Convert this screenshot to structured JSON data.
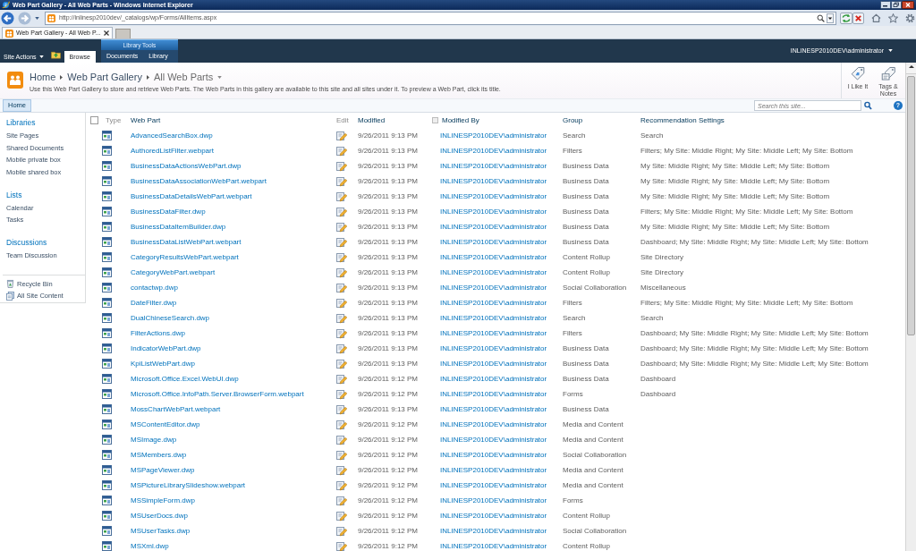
{
  "browser": {
    "title": "Web Part Gallery - All Web Parts - Windows Internet Explorer",
    "address": "http://inlinesp2010dev/_catalogs/wp/Forms/AllItems.aspx",
    "tabs": [
      {
        "label": "Web Part Gallery - All Web P...",
        "selected": true
      }
    ]
  },
  "ribbon": {
    "site_actions": "Site Actions",
    "tabs": [
      {
        "label": "Browse",
        "selected": true
      }
    ],
    "context_group": {
      "label": "Library Tools",
      "tabs": [
        {
          "label": "Documents",
          "selected": false
        },
        {
          "label": "Library",
          "selected": false
        }
      ]
    },
    "user": "INLINESP2010DEV\\administrator"
  },
  "title_area": {
    "breadcrumb": [
      "Home",
      "Web Part Gallery",
      "All Web Parts"
    ],
    "description": "Use this Web Part Gallery to store and retrieve Web Parts. The Web Parts in this gallery are available to this site and all sites under it. To preview a Web Part, click its title.",
    "actions": [
      {
        "kind": "like",
        "label": "I Like It"
      },
      {
        "kind": "tags",
        "label": "Tags & Notes"
      }
    ]
  },
  "top_nav": {
    "tabs": [
      {
        "label": "Home",
        "selected": true
      }
    ],
    "search": {
      "placeholder": "Search this site..."
    },
    "help": "?"
  },
  "quick_launch": {
    "sections": [
      {
        "heading": "Libraries",
        "items": [
          "Site Pages",
          "Shared Documents",
          "Mobile private box",
          "Mobile shared box"
        ]
      },
      {
        "heading": "Lists",
        "items": [
          "Calendar",
          "Tasks"
        ]
      },
      {
        "heading": "Discussions",
        "items": [
          "Team Discussion"
        ]
      }
    ],
    "footer": [
      {
        "kind": "recycle",
        "label": "Recycle Bin"
      },
      {
        "kind": "content",
        "label": "All Site Content"
      }
    ]
  },
  "table": {
    "columns": [
      {
        "kind": "select",
        "checked": false
      },
      {
        "kind": "type",
        "label": "Type",
        "sortable": false
      },
      {
        "kind": "title",
        "label": "Web Part",
        "sortable": true
      },
      {
        "kind": "edit",
        "label": "Edit",
        "sortable": false
      },
      {
        "kind": "modified",
        "label": "Modified",
        "sortable": true
      },
      {
        "kind": "person",
        "label": "Modified By",
        "sortable": true
      },
      {
        "kind": "group",
        "label": "Group",
        "sortable": true
      },
      {
        "kind": "recommendation",
        "label": "Recommendation Settings",
        "sortable": true
      }
    ],
    "rows": [
      {
        "web_part": "AdvancedSearchBox.dwp",
        "modified": "9/26/2011 9:13 PM",
        "modified_by": "INLINESP2010DEV\\administrator",
        "group": "Search",
        "recommendation_settings": "Search"
      },
      {
        "web_part": "AuthoredListFilter.webpart",
        "modified": "9/26/2011 9:13 PM",
        "modified_by": "INLINESP2010DEV\\administrator",
        "group": "Filters",
        "recommendation_settings": "Filters; My Site: Middle Right; My Site: Middle Left; My Site: Bottom"
      },
      {
        "web_part": "BusinessDataActionsWebPart.dwp",
        "modified": "9/26/2011 9:13 PM",
        "modified_by": "INLINESP2010DEV\\administrator",
        "group": "Business Data",
        "recommendation_settings": "My Site: Middle Right; My Site: Middle Left; My Site: Bottom"
      },
      {
        "web_part": "BusinessDataAssociationWebPart.webpart",
        "modified": "9/26/2011 9:13 PM",
        "modified_by": "INLINESP2010DEV\\administrator",
        "group": "Business Data",
        "recommendation_settings": "My Site: Middle Right; My Site: Middle Left; My Site: Bottom"
      },
      {
        "web_part": "BusinessDataDetailsWebPart.webpart",
        "modified": "9/26/2011 9:13 PM",
        "modified_by": "INLINESP2010DEV\\administrator",
        "group": "Business Data",
        "recommendation_settings": "My Site: Middle Right; My Site: Middle Left; My Site: Bottom"
      },
      {
        "web_part": "BusinessDataFilter.dwp",
        "modified": "9/26/2011 9:13 PM",
        "modified_by": "INLINESP2010DEV\\administrator",
        "group": "Business Data",
        "recommendation_settings": "Filters; My Site: Middle Right; My Site: Middle Left; My Site: Bottom"
      },
      {
        "web_part": "BusinessDataItemBuilder.dwp",
        "modified": "9/26/2011 9:13 PM",
        "modified_by": "INLINESP2010DEV\\administrator",
        "group": "Business Data",
        "recommendation_settings": "My Site: Middle Right; My Site: Middle Left; My Site: Bottom"
      },
      {
        "web_part": "BusinessDataListWebPart.webpart",
        "modified": "9/26/2011 9:13 PM",
        "modified_by": "INLINESP2010DEV\\administrator",
        "group": "Business Data",
        "recommendation_settings": "Dashboard; My Site: Middle Right; My Site: Middle Left; My Site: Bottom"
      },
      {
        "web_part": "CategoryResultsWebPart.webpart",
        "modified": "9/26/2011 9:13 PM",
        "modified_by": "INLINESP2010DEV\\administrator",
        "group": "Content Rollup",
        "recommendation_settings": "Site Directory"
      },
      {
        "web_part": "CategoryWebPart.webpart",
        "modified": "9/26/2011 9:13 PM",
        "modified_by": "INLINESP2010DEV\\administrator",
        "group": "Content Rollup",
        "recommendation_settings": "Site Directory"
      },
      {
        "web_part": "contactwp.dwp",
        "modified": "9/26/2011 9:13 PM",
        "modified_by": "INLINESP2010DEV\\administrator",
        "group": "Social Collaboration",
        "recommendation_settings": "Miscellaneous"
      },
      {
        "web_part": "DateFilter.dwp",
        "modified": "9/26/2011 9:13 PM",
        "modified_by": "INLINESP2010DEV\\administrator",
        "group": "Filters",
        "recommendation_settings": "Filters; My Site: Middle Right; My Site: Middle Left; My Site: Bottom"
      },
      {
        "web_part": "DualChineseSearch.dwp",
        "modified": "9/26/2011 9:13 PM",
        "modified_by": "INLINESP2010DEV\\administrator",
        "group": "Search",
        "recommendation_settings": "Search"
      },
      {
        "web_part": "FilterActions.dwp",
        "modified": "9/26/2011 9:13 PM",
        "modified_by": "INLINESP2010DEV\\administrator",
        "group": "Filters",
        "recommendation_settings": "Dashboard; My Site: Middle Right; My Site: Middle Left; My Site: Bottom"
      },
      {
        "web_part": "IndicatorWebPart.dwp",
        "modified": "9/26/2011 9:13 PM",
        "modified_by": "INLINESP2010DEV\\administrator",
        "group": "Business Data",
        "recommendation_settings": "Dashboard; My Site: Middle Right; My Site: Middle Left; My Site: Bottom"
      },
      {
        "web_part": "KpiListWebPart.dwp",
        "modified": "9/26/2011 9:13 PM",
        "modified_by": "INLINESP2010DEV\\administrator",
        "group": "Business Data",
        "recommendation_settings": "Dashboard; My Site: Middle Right; My Site: Middle Left; My Site: Bottom"
      },
      {
        "web_part": "Microsoft.Office.Excel.WebUI.dwp",
        "modified": "9/26/2011 9:12 PM",
        "modified_by": "INLINESP2010DEV\\administrator",
        "group": "Business Data",
        "recommendation_settings": "Dashboard"
      },
      {
        "web_part": "Microsoft.Office.InfoPath.Server.BrowserForm.webpart",
        "modified": "9/26/2011 9:12 PM",
        "modified_by": "INLINESP2010DEV\\administrator",
        "group": "Forms",
        "recommendation_settings": "Dashboard"
      },
      {
        "web_part": "MossChartWebPart.webpart",
        "modified": "9/26/2011 9:13 PM",
        "modified_by": "INLINESP2010DEV\\administrator",
        "group": "Business Data"
      },
      {
        "web_part": "MSContentEditor.dwp",
        "modified": "9/26/2011 9:12 PM",
        "modified_by": "INLINESP2010DEV\\administrator",
        "group": "Media and Content"
      },
      {
        "web_part": "MSImage.dwp",
        "modified": "9/26/2011 9:12 PM",
        "modified_by": "INLINESP2010DEV\\administrator",
        "group": "Media and Content"
      },
      {
        "web_part": "MSMembers.dwp",
        "modified": "9/26/2011 9:12 PM",
        "modified_by": "INLINESP2010DEV\\administrator",
        "group": "Social Collaboration"
      },
      {
        "web_part": "MSPageViewer.dwp",
        "modified": "9/26/2011 9:12 PM",
        "modified_by": "INLINESP2010DEV\\administrator",
        "group": "Media and Content"
      },
      {
        "web_part": "MSPictureLibrarySlideshow.webpart",
        "modified": "9/26/2011 9:12 PM",
        "modified_by": "INLINESP2010DEV\\administrator",
        "group": "Media and Content"
      },
      {
        "web_part": "MSSimpleForm.dwp",
        "modified": "9/26/2011 9:12 PM",
        "modified_by": "INLINESP2010DEV\\administrator",
        "group": "Forms"
      },
      {
        "web_part": "MSUserDocs.dwp",
        "modified": "9/26/2011 9:12 PM",
        "modified_by": "INLINESP2010DEV\\administrator",
        "group": "Content Rollup"
      },
      {
        "web_part": "MSUserTasks.dwp",
        "modified": "9/26/2011 9:12 PM",
        "modified_by": "INLINESP2010DEV\\administrator",
        "group": "Social Collaboration"
      },
      {
        "web_part": "MSXml.dwp",
        "modified": "9/26/2011 9:12 PM",
        "modified_by": "INLINESP2010DEV\\administrator",
        "group": "Content Rollup"
      }
    ]
  }
}
